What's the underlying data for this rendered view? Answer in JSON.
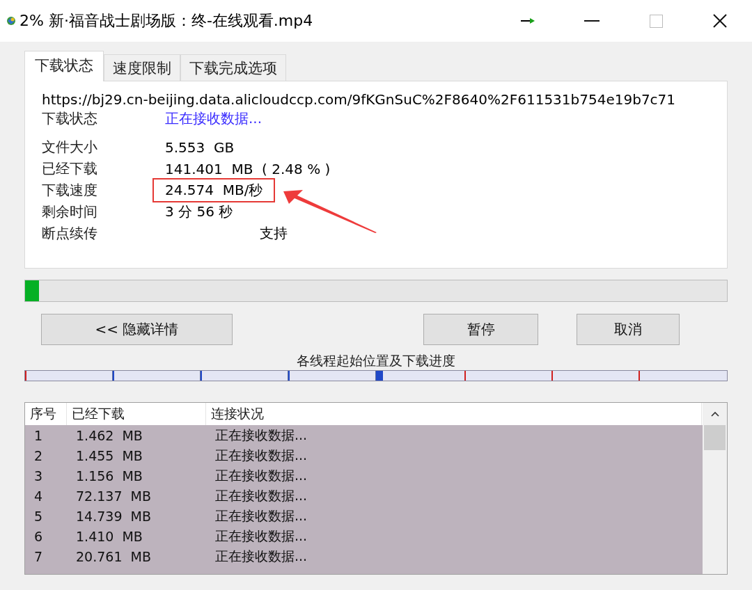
{
  "window": {
    "title": "2% 新·福音战士剧场版：终-在线观看.mp4"
  },
  "tabs": [
    {
      "label": "下载状态",
      "selected": true
    },
    {
      "label": "速度限制",
      "selected": false
    },
    {
      "label": "下载完成选项",
      "selected": false
    }
  ],
  "url": "https://bj29.cn-beijing.data.alicloudccp.com/9fKGnSuC%2F8640%2F611531b754e19b7c71",
  "status": {
    "label": "下载状态",
    "value": "正在接收数据..."
  },
  "details": [
    {
      "label": "文件大小",
      "value": "5.553  GB",
      "highlighted": false
    },
    {
      "label": "已经下载",
      "value": "141.401  MB  ( 2.48 % )",
      "highlighted": false
    },
    {
      "label": "下载速度",
      "value": "24.574  MB/秒",
      "highlighted": true
    },
    {
      "label": "剩余时间",
      "value": "3 分 56 秒",
      "highlighted": false
    },
    {
      "label": "断点续传",
      "value": "支持",
      "highlighted": false
    }
  ],
  "progress": {
    "level": 0.02
  },
  "buttons": {
    "details": "<< 隐藏详情",
    "pause": "暂停",
    "cancel": "取消"
  },
  "threads_label": "各线程起始位置及下载进度",
  "table": {
    "columns": [
      "序号",
      "已经下载",
      "连接状况"
    ],
    "rows": [
      {
        "cells": [
          "1",
          "1.462  MB",
          "正在接收数据..."
        ],
        "selected": true
      },
      {
        "cells": [
          "2",
          "1.455  MB",
          "正在接收数据..."
        ],
        "selected": true
      },
      {
        "cells": [
          "3",
          "1.156  MB",
          "正在接收数据..."
        ],
        "selected": true
      },
      {
        "cells": [
          "4",
          "72.137  MB",
          "正在接收数据..."
        ],
        "selected": true
      },
      {
        "cells": [
          "5",
          "14.739  MB",
          "正在接收数据..."
        ],
        "selected": true
      },
      {
        "cells": [
          "6",
          "1.410  MB",
          "正在接收数据..."
        ],
        "selected": true
      },
      {
        "cells": [
          "7",
          "20.761  MB",
          "正在接收数据..."
        ],
        "selected": true
      }
    ]
  }
}
